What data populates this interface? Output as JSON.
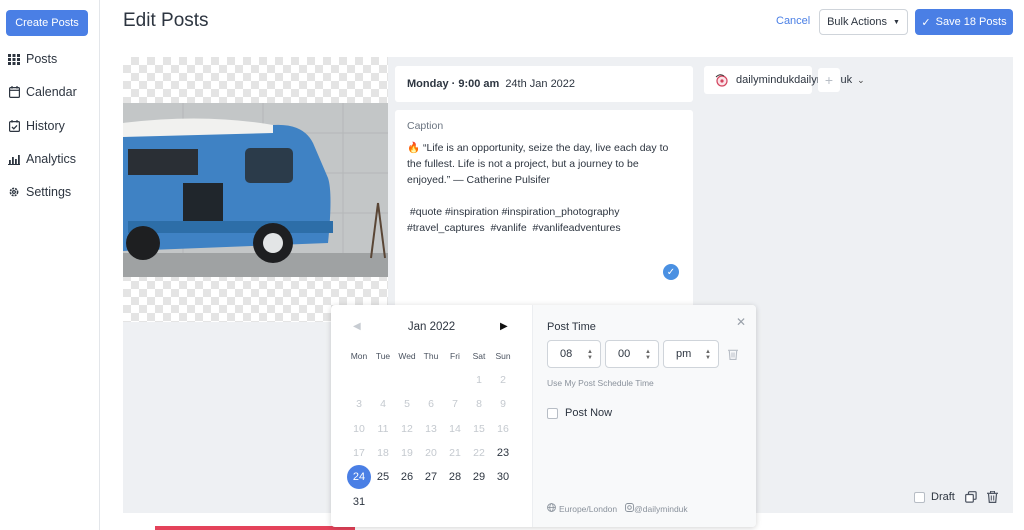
{
  "sidebar": {
    "create_label": "Create Posts",
    "items": [
      {
        "label": "Posts",
        "icon": "grid-icon"
      },
      {
        "label": "Calendar",
        "icon": "calendar-icon"
      },
      {
        "label": "History",
        "icon": "history-icon"
      },
      {
        "label": "Analytics",
        "icon": "analytics-icon"
      },
      {
        "label": "Settings",
        "icon": "gear-icon"
      }
    ]
  },
  "header": {
    "title": "Edit Posts",
    "cancel_label": "Cancel",
    "bulk_label": "Bulk Actions",
    "save_label": "Save 18 Posts"
  },
  "post": {
    "day_time": "Monday · 9:00 am",
    "date": "24th Jan 2022",
    "caption_label": "Caption",
    "caption_text": "🔥 “Life is an opportunity, seize the day, live each day to the fullest. Life is not a project, but a journey to be enjoyed.” — Catherine Pulsifer\n\n #quote #inspiration #inspiration_photography #travel_captures  #vanlife  #vanlifeadventures",
    "account": "dailymindukdailyminduk",
    "draft_label": "Draft"
  },
  "calendar": {
    "month_label": "Jan 2022",
    "weekdays": [
      "Mon",
      "Tue",
      "Wed",
      "Thu",
      "Fri",
      "Sat",
      "Sun"
    ],
    "weeks": [
      [
        "",
        "",
        "",
        "",
        "",
        "1",
        "2"
      ],
      [
        "3",
        "4",
        "5",
        "6",
        "7",
        "8",
        "9"
      ],
      [
        "10",
        "11",
        "12",
        "13",
        "14",
        "15",
        "16"
      ],
      [
        "17",
        "18",
        "19",
        "20",
        "21",
        "22",
        "23"
      ],
      [
        "24",
        "25",
        "26",
        "27",
        "28",
        "29",
        "30"
      ],
      [
        "31",
        "",
        "",
        "",
        "",
        "",
        ""
      ]
    ],
    "selected_day": "24",
    "first_enabled_day": "23"
  },
  "time": {
    "label": "Post Time",
    "hour": "08",
    "minute": "00",
    "ampm": "pm",
    "use_schedule_label": "Use My Post Schedule Time",
    "post_now_label": "Post Now",
    "timezone": "Europe/London",
    "account_handle": "@dailyminduk"
  },
  "colors": {
    "accent": "#4a7fe5",
    "panel_bg": "#eef0f3",
    "van_blue": "#3f82c4"
  }
}
